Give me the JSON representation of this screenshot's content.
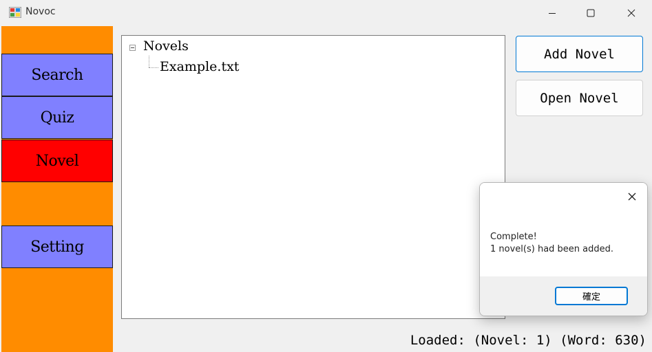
{
  "window": {
    "title": "Novoc",
    "icon": "app-windows-icon",
    "controls": [
      "minimize-icon",
      "maximize-icon",
      "close-icon"
    ]
  },
  "sidebar": {
    "background": "#ff8c00",
    "items": [
      {
        "label": "Search",
        "active": false
      },
      {
        "label": "Quiz",
        "active": false
      },
      {
        "label": "Novel",
        "active": true
      },
      {
        "label": "Setting",
        "active": false
      }
    ],
    "colors": {
      "normal": "#8080ff",
      "active": "#ff0000"
    }
  },
  "tree": {
    "root": "Novels",
    "children": [
      "Example.txt"
    ]
  },
  "actions": {
    "add_novel": "Add Novel",
    "open_novel": "Open Novel"
  },
  "status": "Loaded: (Novel: 1) (Word: 630)",
  "dialog": {
    "line1": "Complete!",
    "line2": "1 novel(s) had been added.",
    "ok": "確定"
  }
}
